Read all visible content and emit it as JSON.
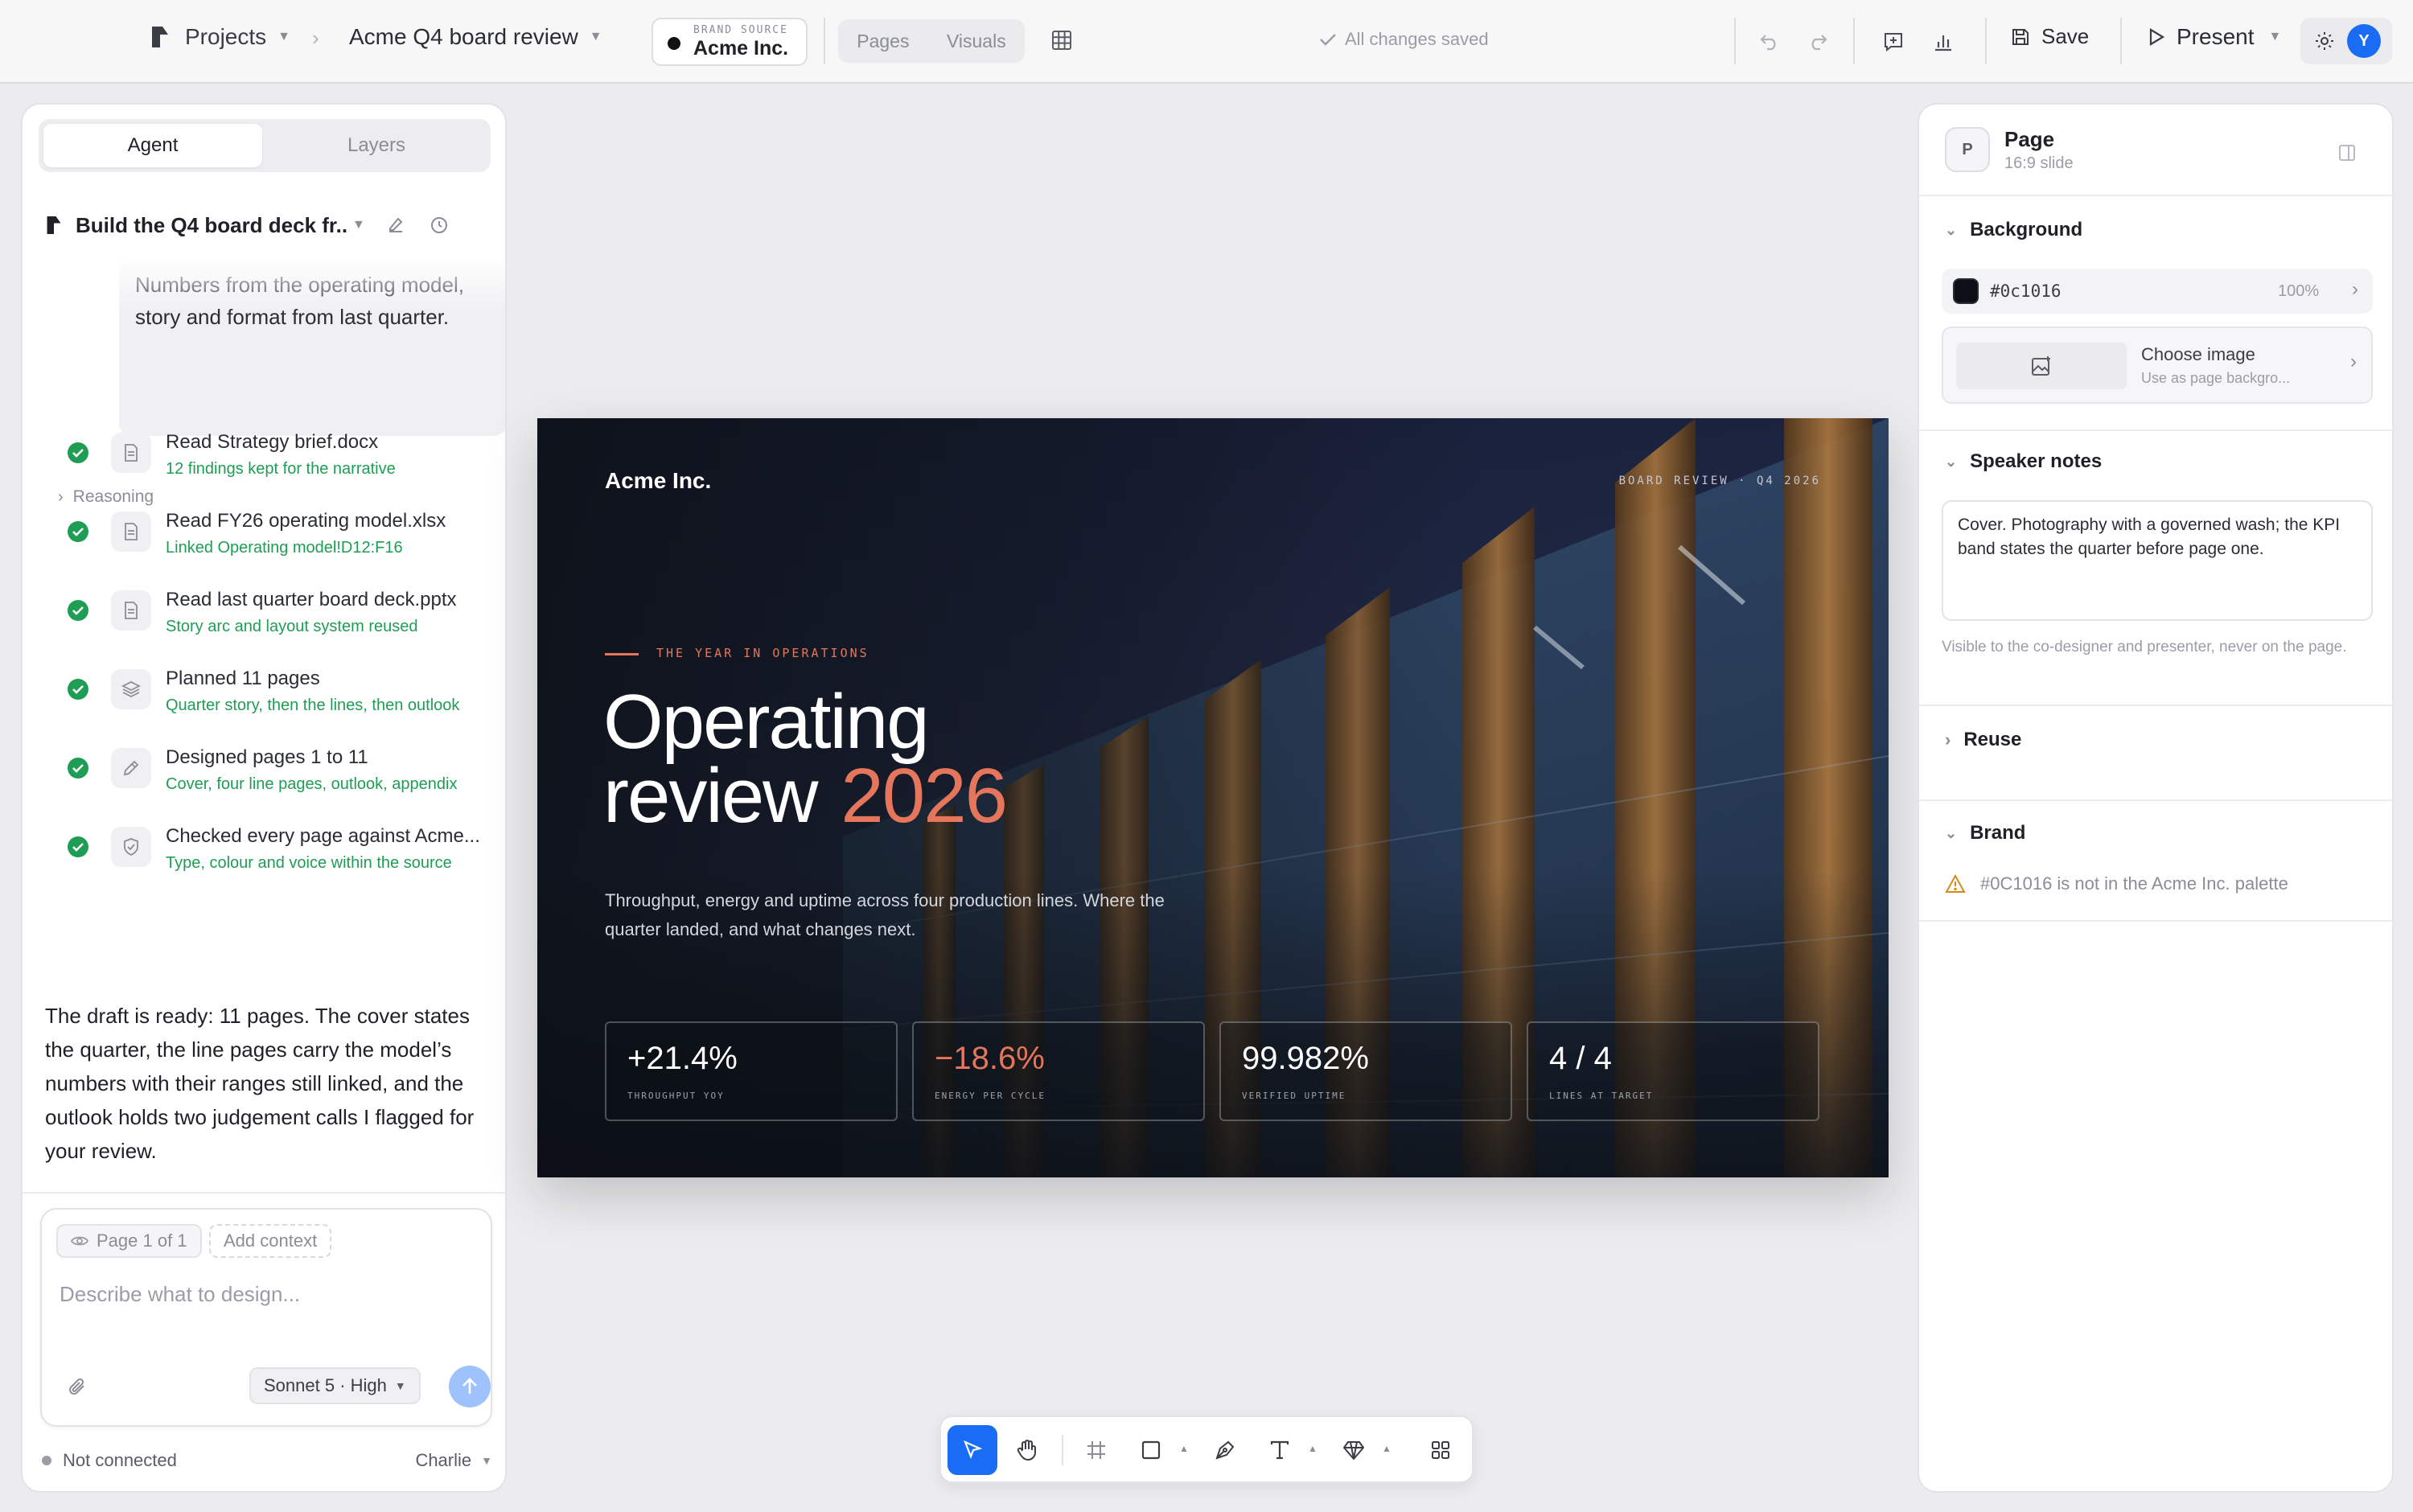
{
  "topbar": {
    "projects_label": "Projects",
    "file_name": "Acme Q4 board review",
    "brand_source_label": "BRAND SOURCE",
    "brand_source_value": "Acme Inc.",
    "view_tabs": [
      "Pages",
      "Visuals"
    ],
    "save_status": "All changes saved",
    "save_label": "Save",
    "present_label": "Present",
    "avatar_initial": "Y"
  },
  "left": {
    "tabs": [
      "Agent",
      "Layers"
    ],
    "thread_title": "Build the Q4 board deck fr...",
    "user_message": "Numbers from the operating model, story and format from last quarter.",
    "reasoning_label": "Reasoning",
    "steps": [
      {
        "title": "Read Strategy brief.docx",
        "detail": "12 findings kept for the narrative",
        "icon": "file-icon"
      },
      {
        "title": "Read FY26 operating model.xlsx",
        "detail": "Linked Operating model!D12:F16",
        "icon": "file-icon"
      },
      {
        "title": "Read last quarter board deck.pptx",
        "detail": "Story arc and layout system reused",
        "icon": "file-icon"
      },
      {
        "title": "Planned 11 pages",
        "detail": "Quarter story, then the lines, then outlook",
        "icon": "layers-icon"
      },
      {
        "title": "Designed pages 1 to 11",
        "detail": "Cover, four line pages, outlook, appendix",
        "icon": "pen-icon"
      },
      {
        "title": "Checked every page against Acme...",
        "detail": "Type, colour and voice within the source",
        "icon": "shield-icon"
      }
    ],
    "agent_message": "The draft is ready: 11 pages. The cover states the quarter, the line pages carry the model’s numbers with their ranges still linked, and the outlook holds two judgement calls I flagged for your review.",
    "composer": {
      "page_chip": "Page 1 of 1",
      "add_context": "Add context",
      "placeholder": "Describe what to design...",
      "model": "Sonnet 5 · High"
    },
    "status": {
      "connection": "Not connected",
      "user": "Charlie"
    }
  },
  "slide": {
    "brand": "Acme Inc.",
    "meta": "BOARD REVIEW · Q4 2026",
    "eyebrow": "THE YEAR IN OPERATIONS",
    "headline_line1": "Operating",
    "headline_line2": "review",
    "headline_accent": "2026",
    "subtitle": "Throughput, energy and uptime across four production lines. Where the quarter landed, and what changes next.",
    "kpis": [
      {
        "value": "+21.4%",
        "label": "THROUGHPUT YOY",
        "accent": false
      },
      {
        "value": "−18.6%",
        "label": "ENERGY PER CYCLE",
        "accent": true
      },
      {
        "value": "99.982%",
        "label": "VERIFIED UPTIME",
        "accent": false
      },
      {
        "value": "4 / 4",
        "label": "LINES AT TARGET",
        "accent": false
      }
    ],
    "background_color": "#0c1016",
    "accent_color": "#e5765c"
  },
  "right": {
    "badge": "P",
    "title": "Page",
    "subtitle": "16:9 slide",
    "background_section": "Background",
    "background_hex": "#0c1016",
    "background_opacity": "100%",
    "choose_image_title": "Choose image",
    "choose_image_sub": "Use as page backgro...",
    "notes_section": "Speaker notes",
    "notes_text": "Cover. Photography with a governed wash; the KPI band states the quarter before page one.",
    "notes_hint": "Visible to the co-designer and presenter, never on the page.",
    "reuse_section": "Reuse",
    "brand_section": "Brand",
    "brand_warning": "#0C1016 is not in the Acme Inc. palette"
  }
}
